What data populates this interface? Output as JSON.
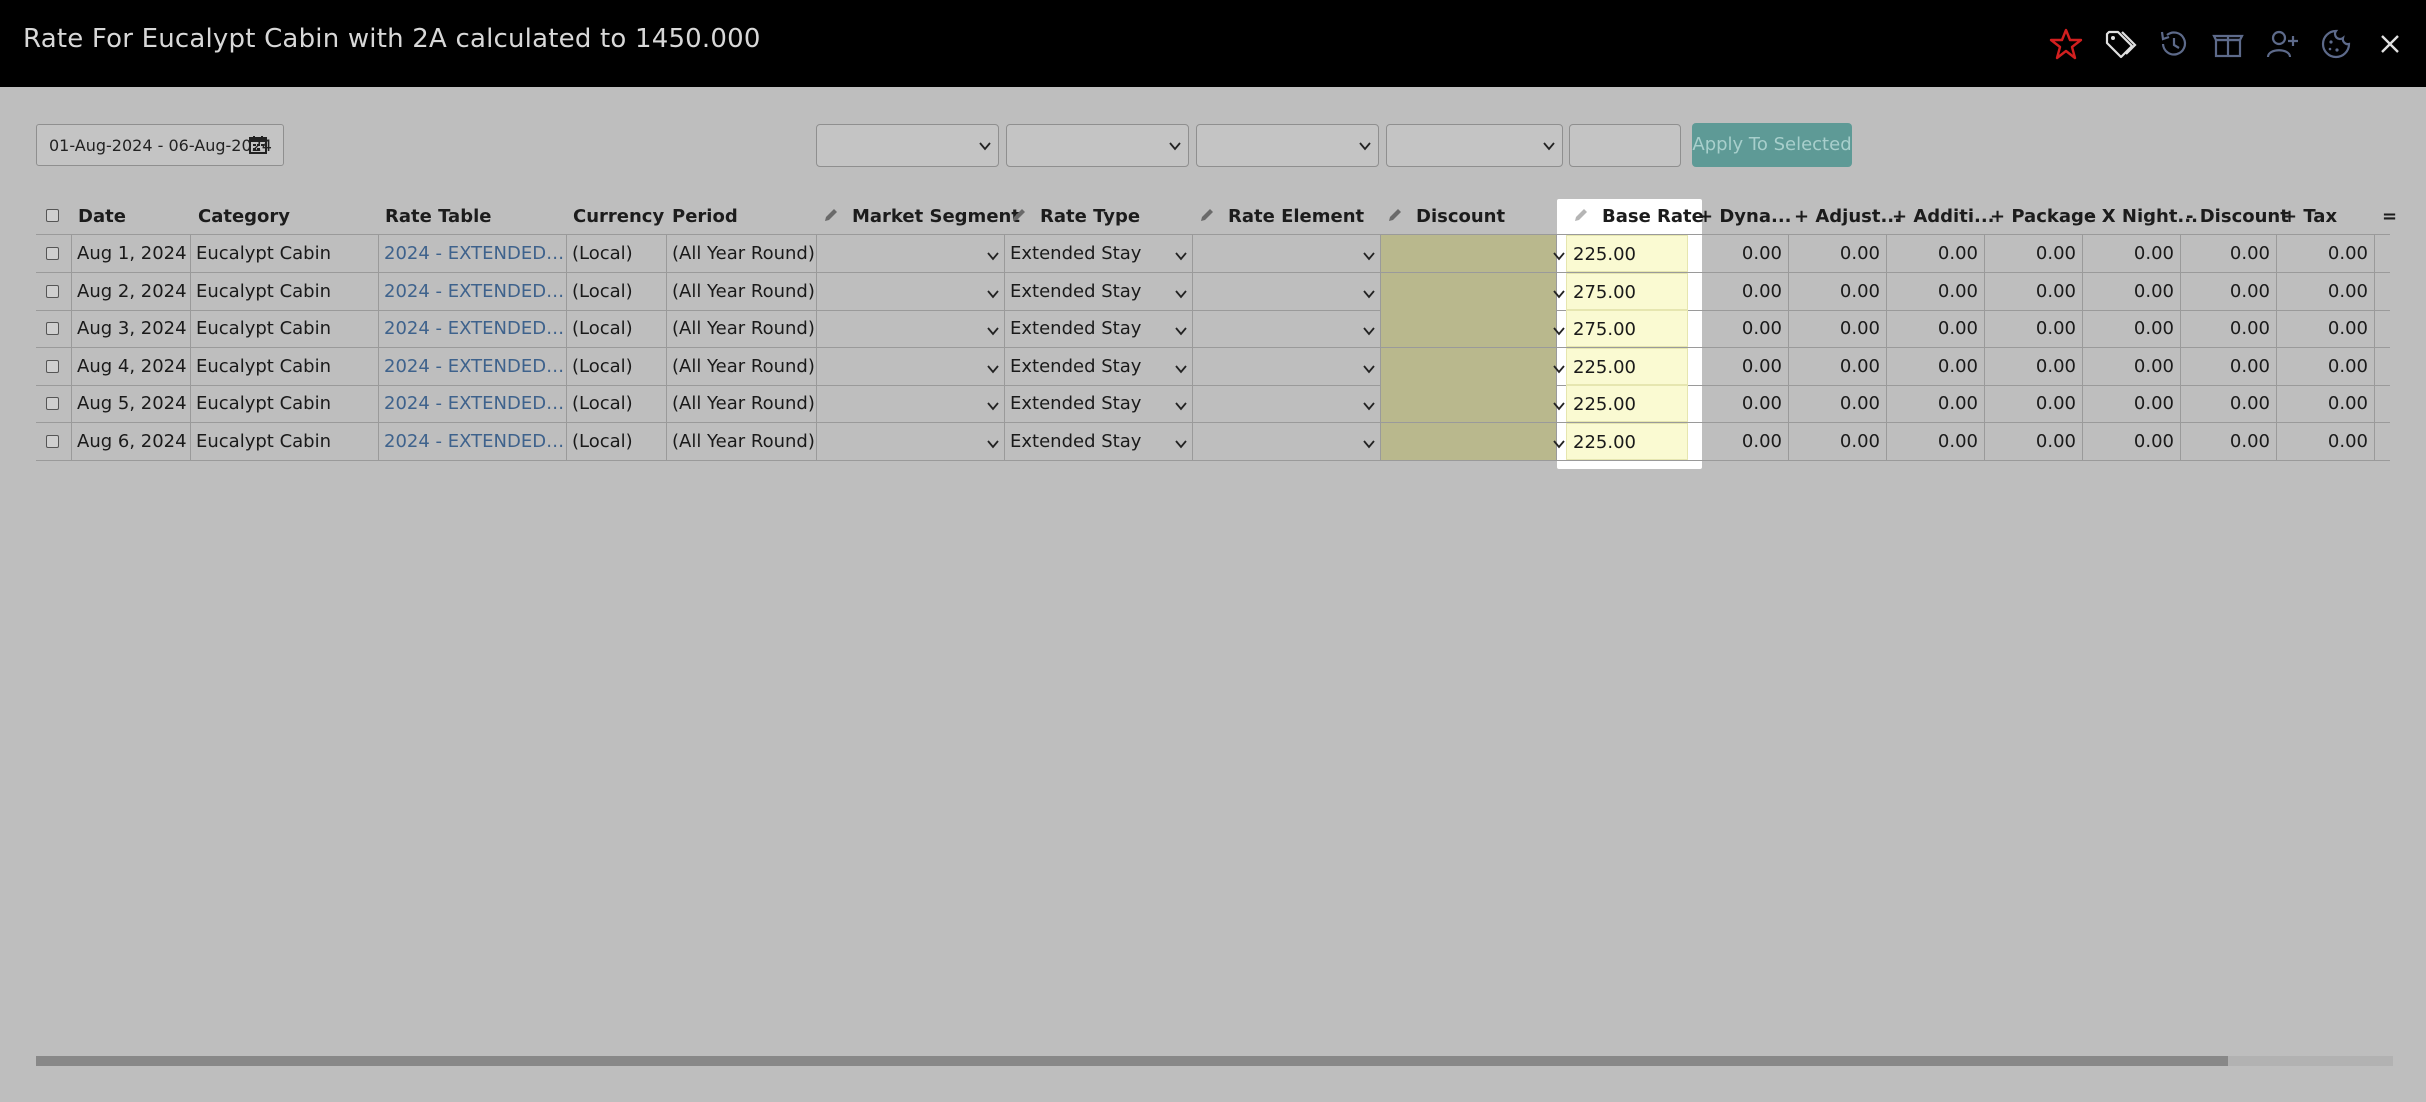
{
  "window": {
    "title": "Rate For Eucalypt Cabin with 2A calculated to 1450.000",
    "icons": [
      "star-icon",
      "tags-icon",
      "history-icon",
      "package-icon",
      "add-guest-icon",
      "cookie-icon",
      "close-icon"
    ]
  },
  "filters": {
    "date_range": "01-Aug-2024 - 06-Aug-2024",
    "apply_label": "Apply To Selected"
  },
  "table": {
    "headers": {
      "date": "Date",
      "category": "Category",
      "rate_table": "Rate Table",
      "currency": "Currency",
      "period": "Period",
      "market_segment": "Market Segment",
      "rate_type": "Rate Type",
      "rate_element": "Rate Element",
      "discount": "Discount",
      "base_rate": "Base Rate",
      "dynamic": "+ Dyna...",
      "adjust": "+ Adjust...",
      "additional": "+ Additi...",
      "package": "+ Package",
      "x_night": "- X Night...",
      "minus_discount": "- Discount",
      "tax": "+ Tax",
      "equals": "="
    },
    "rows": [
      {
        "date": "Aug 1, 2024",
        "category": "Eucalypt Cabin",
        "rate_table": "2024 - EXTENDED S...",
        "currency": "(Local)",
        "period": "(All Year Round)",
        "market_segment": "",
        "rate_type": "Extended Stay",
        "rate_element": "",
        "discount": "",
        "base_rate": "225.00",
        "dynamic": "0.00",
        "adjust": "0.00",
        "additional": "0.00",
        "package": "0.00",
        "x_night": "0.00",
        "minus_discount": "0.00",
        "tax": "0.00"
      },
      {
        "date": "Aug 2, 2024",
        "category": "Eucalypt Cabin",
        "rate_table": "2024 - EXTENDED S...",
        "currency": "(Local)",
        "period": "(All Year Round)",
        "market_segment": "",
        "rate_type": "Extended Stay",
        "rate_element": "",
        "discount": "",
        "base_rate": "275.00",
        "dynamic": "0.00",
        "adjust": "0.00",
        "additional": "0.00",
        "package": "0.00",
        "x_night": "0.00",
        "minus_discount": "0.00",
        "tax": "0.00"
      },
      {
        "date": "Aug 3, 2024",
        "category": "Eucalypt Cabin",
        "rate_table": "2024 - EXTENDED S...",
        "currency": "(Local)",
        "period": "(All Year Round)",
        "market_segment": "",
        "rate_type": "Extended Stay",
        "rate_element": "",
        "discount": "",
        "base_rate": "275.00",
        "dynamic": "0.00",
        "adjust": "0.00",
        "additional": "0.00",
        "package": "0.00",
        "x_night": "0.00",
        "minus_discount": "0.00",
        "tax": "0.00"
      },
      {
        "date": "Aug 4, 2024",
        "category": "Eucalypt Cabin",
        "rate_table": "2024 - EXTENDED S...",
        "currency": "(Local)",
        "period": "(All Year Round)",
        "market_segment": "",
        "rate_type": "Extended Stay",
        "rate_element": "",
        "discount": "",
        "base_rate": "225.00",
        "dynamic": "0.00",
        "adjust": "0.00",
        "additional": "0.00",
        "package": "0.00",
        "x_night": "0.00",
        "minus_discount": "0.00",
        "tax": "0.00"
      },
      {
        "date": "Aug 5, 2024",
        "category": "Eucalypt Cabin",
        "rate_table": "2024 - EXTENDED S...",
        "currency": "(Local)",
        "period": "(All Year Round)",
        "market_segment": "",
        "rate_type": "Extended Stay",
        "rate_element": "",
        "discount": "",
        "base_rate": "225.00",
        "dynamic": "0.00",
        "adjust": "0.00",
        "additional": "0.00",
        "package": "0.00",
        "x_night": "0.00",
        "minus_discount": "0.00",
        "tax": "0.00"
      },
      {
        "date": "Aug 6, 2024",
        "category": "Eucalypt Cabin",
        "rate_table": "2024 - EXTENDED S...",
        "currency": "(Local)",
        "period": "(All Year Round)",
        "market_segment": "",
        "rate_type": "Extended Stay",
        "rate_element": "",
        "discount": "",
        "base_rate": "225.00",
        "dynamic": "0.00",
        "adjust": "0.00",
        "additional": "0.00",
        "package": "0.00",
        "x_night": "0.00",
        "minus_discount": "0.00",
        "tax": "0.00"
      }
    ]
  },
  "colors": {
    "accent_star": "#d21f1f",
    "apply_button": "#5e9a96",
    "link": "#3e628c",
    "base_rate_bg": "#fafad2"
  }
}
